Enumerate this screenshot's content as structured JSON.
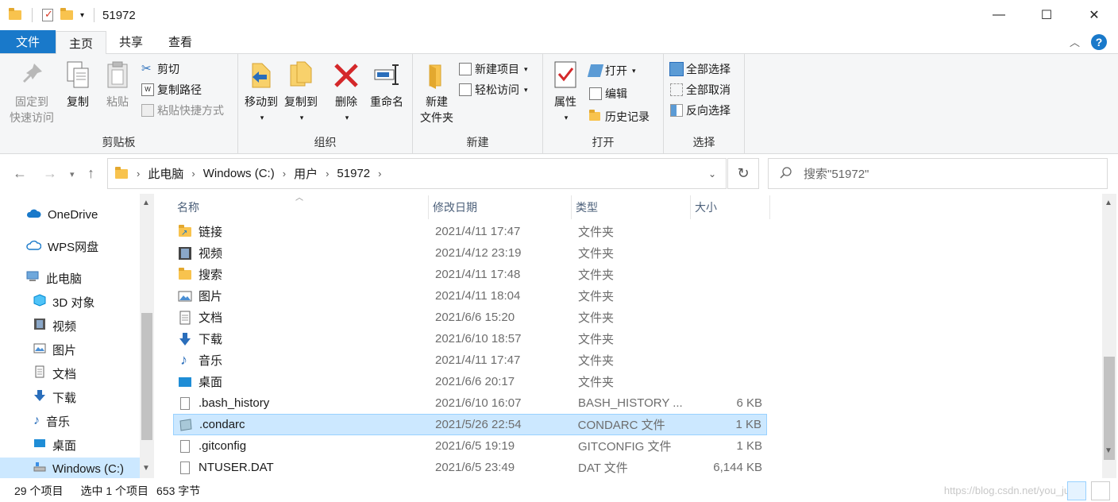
{
  "window": {
    "title": "51972",
    "controls": {
      "minimize": "—",
      "maximize": "☐",
      "close": "✕"
    }
  },
  "tabs": [
    "文件",
    "主页",
    "共享",
    "查看"
  ],
  "ribbon": {
    "clipboard": {
      "label": "剪贴板",
      "pin": "固定到\n快速访问",
      "copy": "复制",
      "paste": "粘贴",
      "cut": "剪切",
      "copy_path": "复制路径",
      "paste_shortcut": "粘贴快捷方式"
    },
    "organize": {
      "label": "组织",
      "move_to": "移动到",
      "copy_to": "复制到",
      "delete": "删除",
      "rename": "重命名"
    },
    "new": {
      "label": "新建",
      "new_folder": "新建\n文件夹",
      "new_item": "新建项目",
      "easy_access": "轻松访问"
    },
    "open": {
      "label": "打开",
      "properties": "属性",
      "open": "打开",
      "edit": "编辑",
      "history": "历史记录"
    },
    "select": {
      "label": "选择",
      "select_all": "全部选择",
      "select_none": "全部取消",
      "invert": "反向选择"
    }
  },
  "address": {
    "crumbs": [
      "此电脑",
      "Windows (C:)",
      "用户",
      "51972"
    ]
  },
  "search": {
    "placeholder": "搜索\"51972\""
  },
  "nav": [
    {
      "label": "OneDrive"
    },
    {
      "label": "WPS网盘"
    },
    {
      "label": "此电脑"
    },
    {
      "label": "3D 对象"
    },
    {
      "label": "视频"
    },
    {
      "label": "图片"
    },
    {
      "label": "文档"
    },
    {
      "label": "下载"
    },
    {
      "label": "音乐"
    },
    {
      "label": "桌面"
    },
    {
      "label": "Windows (C:)"
    }
  ],
  "columns": [
    "名称",
    "修改日期",
    "类型",
    "大小"
  ],
  "files": [
    {
      "name": "链接",
      "date": "2021/4/11 17:47",
      "type": "文件夹",
      "size": "",
      "icon": "links-folder-icon"
    },
    {
      "name": "视频",
      "date": "2021/4/12 23:19",
      "type": "文件夹",
      "size": "",
      "icon": "videos-folder-icon"
    },
    {
      "name": "搜索",
      "date": "2021/4/11 17:48",
      "type": "文件夹",
      "size": "",
      "icon": "searches-folder-icon"
    },
    {
      "name": "图片",
      "date": "2021/4/11 18:04",
      "type": "文件夹",
      "size": "",
      "icon": "pictures-folder-icon"
    },
    {
      "name": "文档",
      "date": "2021/6/6 15:20",
      "type": "文件夹",
      "size": "",
      "icon": "documents-folder-icon"
    },
    {
      "name": "下载",
      "date": "2021/6/10 18:57",
      "type": "文件夹",
      "size": "",
      "icon": "downloads-folder-icon"
    },
    {
      "name": "音乐",
      "date": "2021/4/11 17:47",
      "type": "文件夹",
      "size": "",
      "icon": "music-folder-icon"
    },
    {
      "name": "桌面",
      "date": "2021/6/6 20:17",
      "type": "文件夹",
      "size": "",
      "icon": "desktop-folder-icon"
    },
    {
      "name": ".bash_history",
      "date": "2021/6/10 16:07",
      "type": "BASH_HISTORY ...",
      "size": "6 KB",
      "icon": "file-icon"
    },
    {
      "name": ".condarc",
      "date": "2021/5/26 22:54",
      "type": "CONDARC 文件",
      "size": "1 KB",
      "icon": "condarc-file-icon"
    },
    {
      "name": ".gitconfig",
      "date": "2021/6/5 19:19",
      "type": "GITCONFIG 文件",
      "size": "1 KB",
      "icon": "file-icon"
    },
    {
      "name": "NTUSER.DAT",
      "date": "2021/6/5 23:49",
      "type": "DAT 文件",
      "size": "6,144 KB",
      "icon": "file-icon"
    }
  ],
  "status": {
    "count": "29 个项目",
    "selected": "选中 1 个项目",
    "size": "653 字节",
    "watermark": "https://blog.csdn.net/you_ju..."
  },
  "colors": {
    "accent": "#1979ca",
    "selection": "#cce8ff",
    "folder": "#f8c34e"
  }
}
